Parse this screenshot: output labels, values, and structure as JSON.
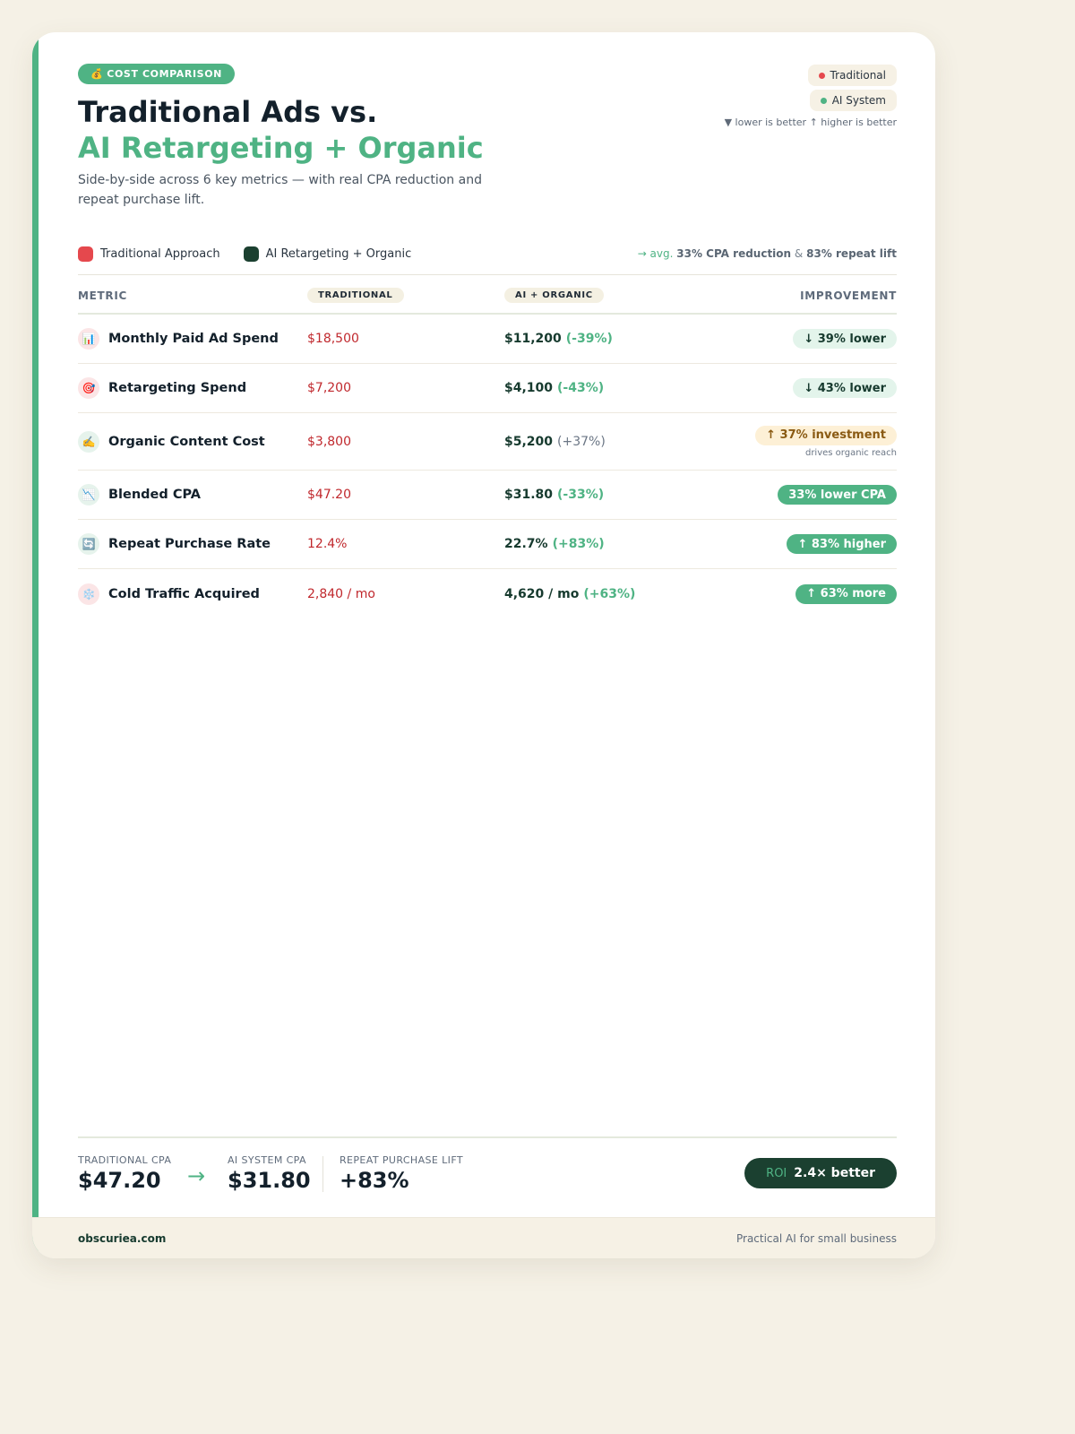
{
  "header": {
    "badge_icon": "💰",
    "badge_label": "COST COMPARISON",
    "title_line1": "Traditional Ads vs.",
    "title_line2": "AI Retargeting + Organic",
    "subtitle": "Side-by-side across 6 key metrics — with real CPA reduction and repeat purchase lift."
  },
  "legend": {
    "traditional_label": "Traditional",
    "ai_label": "AI System",
    "hint": "▼ lower is better ↑ higher is better"
  },
  "key": {
    "traditional_label": "Traditional Approach",
    "ai_label": "AI Retargeting + Organic",
    "summary_prefix": "→ avg.",
    "summary_cpa": "33% CPA reduction",
    "summary_amp": "&",
    "summary_repeat": "83% repeat lift"
  },
  "colors": {
    "accent": "#4fb384",
    "traditional": "#e5484d",
    "ai": "#1b4030",
    "traditional_value": "#c0282d"
  },
  "table": {
    "headers": {
      "metric": "METRIC",
      "traditional": "TRADITIONAL",
      "ai": "AI + ORGANIC",
      "improvement": "IMPROVEMENT"
    },
    "rows": [
      {
        "icon": "📊",
        "icon_name": "bar-chart-icon",
        "metric": "Monthly Paid Ad Spend",
        "traditional": "$18,500",
        "ai_value": "$11,200",
        "ai_delta": "(-39%)",
        "improvement": "↓ 39% lower",
        "note": ""
      },
      {
        "icon": "🎯",
        "icon_name": "target-icon",
        "metric": "Retargeting Spend",
        "traditional": "$7,200",
        "ai_value": "$4,100",
        "ai_delta": "(-43%)",
        "improvement": "↓ 43% lower",
        "note": ""
      },
      {
        "icon": "✍️",
        "icon_name": "writing-hand-icon",
        "metric": "Organic Content Cost",
        "traditional": "$3,800",
        "ai_value": "$5,200",
        "ai_delta": "(+37%)",
        "improvement": "↑ 37% investment",
        "note": "drives organic reach"
      },
      {
        "icon": "📉",
        "icon_name": "chart-decreasing-icon",
        "metric": "Blended CPA",
        "traditional": "$47.20",
        "ai_value": "$31.80",
        "ai_delta": "(-33%)",
        "improvement": "33% lower CPA",
        "note": ""
      },
      {
        "icon": "🔄",
        "icon_name": "repeat-icon",
        "metric": "Repeat Purchase Rate",
        "traditional": "12.4%",
        "ai_value": "22.7%",
        "ai_delta": "(+83%)",
        "improvement": "↑ 83% higher",
        "note": ""
      },
      {
        "icon": "❄️",
        "icon_name": "snowflake-icon",
        "metric": "Cold Traffic Acquired",
        "traditional": "2,840 / mo",
        "ai_value": "4,620 / mo",
        "ai_delta": "(+63%)",
        "improvement": "↑ 63% more",
        "note": ""
      }
    ]
  },
  "summary": {
    "traditional_cpa_label": "TRADITIONAL CPA",
    "traditional_cpa_value": "$47.20",
    "arrow": "→",
    "ai_cpa_label": "AI SYSTEM CPA",
    "ai_cpa_value": "$31.80",
    "repeat_lift_label": "REPEAT PURCHASE LIFT",
    "repeat_lift_value": "+83%",
    "roi_label": "ROI",
    "roi_value": "2.4× better"
  },
  "footer": {
    "brand": "obscuriea.com",
    "tagline": "Practical AI for small business"
  }
}
